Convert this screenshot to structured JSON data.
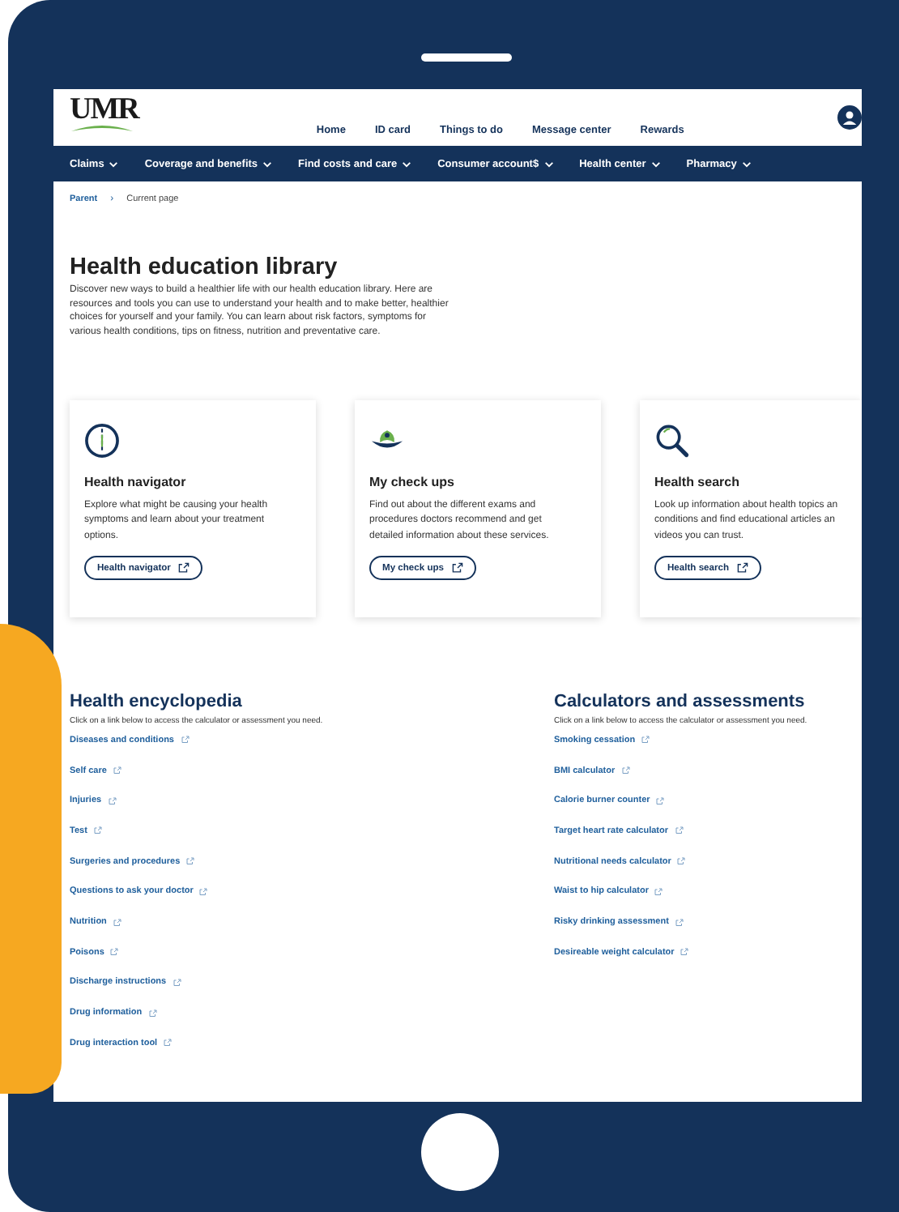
{
  "header": {
    "logo": "UMR",
    "top_links": [
      "Home",
      "ID card",
      "Things to do",
      "Message center",
      "Rewards"
    ]
  },
  "main_nav": [
    {
      "label": "Claims"
    },
    {
      "label": "Coverage and benefits"
    },
    {
      "label": "Find costs and care"
    },
    {
      "label": "Consumer account$"
    },
    {
      "label": "Health center"
    },
    {
      "label": "Pharmacy"
    }
  ],
  "breadcrumb": {
    "parent": "Parent",
    "separator": "›",
    "current": "Current page"
  },
  "intro": {
    "title": "Health education library",
    "text": "Discover new ways to build a healthier life with our health education library. Here are resources and tools you can use to understand your health and to make better, healthier choices for yourself and your family. You can learn about risk factors, symptoms for various health conditions, tips on fitness, nutrition and preventative care."
  },
  "cards": [
    {
      "title": "Health navigator",
      "lines": [
        "Explore what might be causing your health",
        "symptoms and learn about your treatment",
        "options."
      ],
      "button": "Health navigator"
    },
    {
      "title": "My check ups",
      "lines": [
        "Find out about the different exams and",
        "procedures doctors recommend and get",
        "detailed information about these services."
      ],
      "button": "My check ups"
    },
    {
      "title": "Health search",
      "lines": [
        "Look up information about health topics an",
        "conditions and find educational articles an",
        "videos you can trust."
      ],
      "button": "Health search"
    }
  ],
  "sections": [
    {
      "title": "Health encyclopedia",
      "subtitle": "Click on a link below to access the calculator or assessment you need.",
      "links": [
        "Diseases and conditions",
        "Self care",
        "Injuries",
        "Test",
        "Surgeries and procedures",
        "Questions to ask your doctor",
        "Nutrition",
        "Poisons",
        "Discharge instructions",
        "Drug information",
        "Drug interaction tool"
      ]
    },
    {
      "title": "Calculators and assessments",
      "subtitle": "Click on a link below to access the calculator or assessment you need.",
      "links": [
        "Smoking cessation",
        "BMI calculator",
        "Calorie burner counter",
        "Target heart rate calculator",
        "Nutritional needs calculator",
        "Waist to hip calculator",
        "Risky drinking assessment",
        "Desireable weight calculator"
      ]
    }
  ]
}
